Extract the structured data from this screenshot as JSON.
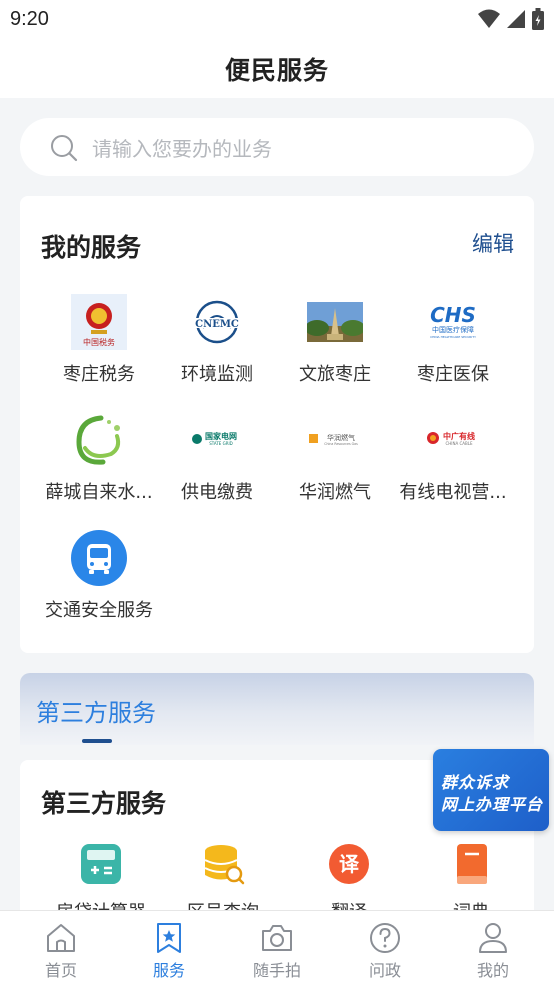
{
  "status_bar": {
    "time": "9:20"
  },
  "header": {
    "title": "便民服务"
  },
  "search": {
    "placeholder": "请输入您要办的业务"
  },
  "my_services": {
    "title": "我的服务",
    "edit_label": "编辑",
    "items": [
      {
        "label": "枣庄税务",
        "icon": "tax-emblem-icon"
      },
      {
        "label": "环境监测",
        "icon": "env-monitor-logo-icon"
      },
      {
        "label": "文旅枣庄",
        "icon": "tourism-photo-icon"
      },
      {
        "label": "枣庄医保",
        "icon": "chs-medical-insurance-icon"
      },
      {
        "label": "薛城自来水...",
        "icon": "water-supply-logo-icon"
      },
      {
        "label": "供电缴费",
        "icon": "state-grid-logo-icon"
      },
      {
        "label": "华润燃气",
        "icon": "cr-gas-logo-icon"
      },
      {
        "label": "有线电视营...",
        "icon": "china-cable-logo-icon"
      },
      {
        "label": "交通安全服务",
        "icon": "bus-icon"
      }
    ],
    "logo_text": {
      "tax": "中国税务",
      "env": "CNEMC",
      "chs": "CHS",
      "chs_sub": "中国医疗保障",
      "chs_sub2": "CHINA HEALTHCARE SECURITY",
      "grid": "国家电网",
      "grid_sub": "STATE GRID",
      "gas": "华润燃气",
      "gas_sub": "China Resources Gas",
      "cable": "中广有线",
      "cable_sub": "CHINA CABLE"
    }
  },
  "third_party_tab": {
    "title": "第三方服务"
  },
  "third_party": {
    "title": "第三方服务",
    "items": [
      {
        "label": "房贷计算器",
        "icon": "calculator-icon"
      },
      {
        "label": "区号查询",
        "icon": "database-search-icon"
      },
      {
        "label": "翻译",
        "icon": "translate-icon",
        "glyph": "译"
      },
      {
        "label": "词典",
        "icon": "book-icon"
      }
    ]
  },
  "float_banner": {
    "line1": "群众诉求",
    "line2": "网上办理平台"
  },
  "bottom_nav": {
    "items": [
      {
        "label": "首页",
        "icon": "home-icon"
      },
      {
        "label": "服务",
        "icon": "bookmark-star-icon",
        "active": true
      },
      {
        "label": "随手拍",
        "icon": "camera-icon"
      },
      {
        "label": "问政",
        "icon": "question-icon"
      },
      {
        "label": "我的",
        "icon": "user-icon"
      }
    ]
  },
  "colors": {
    "accent": "#2d7fde",
    "edit": "#1f4f8f",
    "inactive": "#8a8e95"
  }
}
